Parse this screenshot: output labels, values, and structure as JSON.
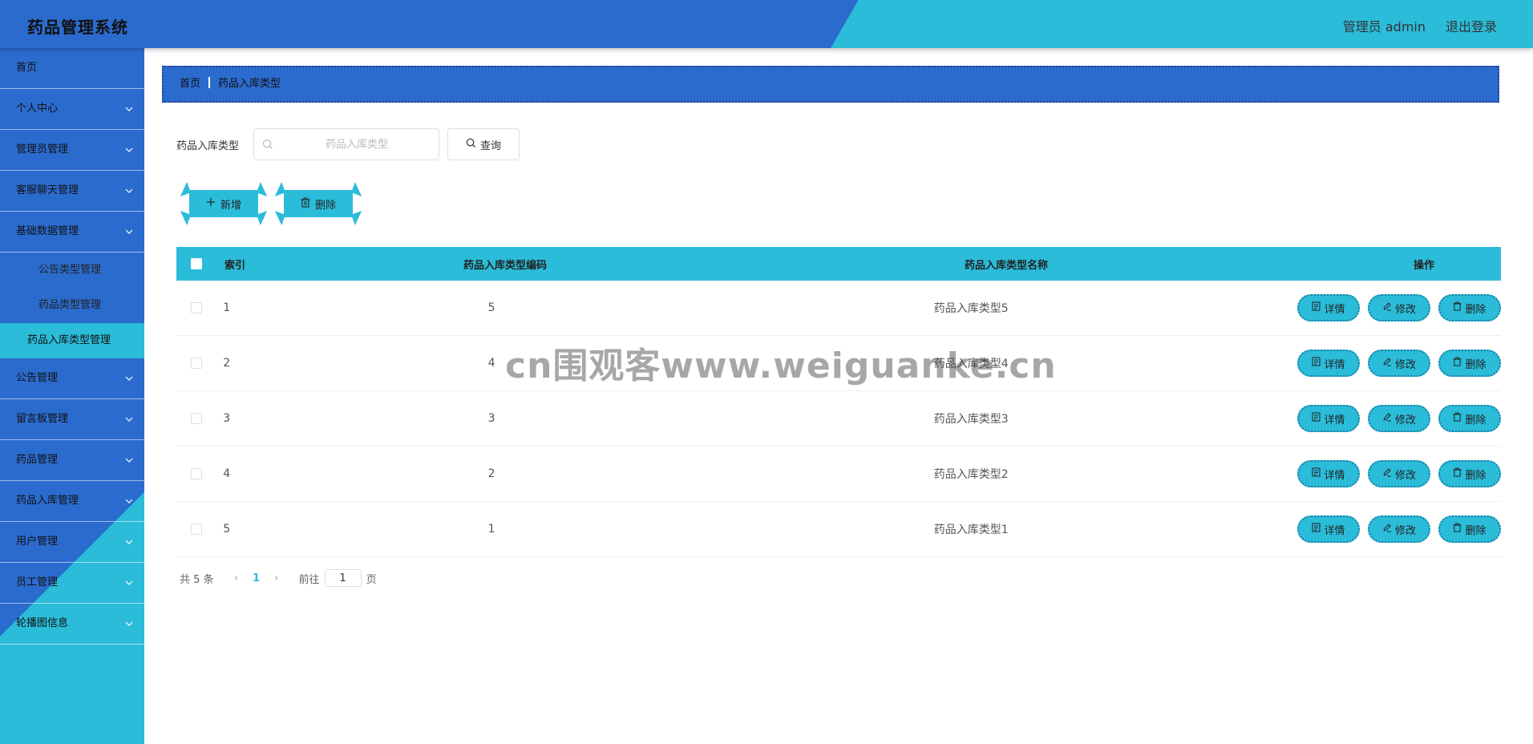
{
  "header": {
    "title": "药品管理系统",
    "user": "管理员 admin",
    "logout": "退出登录"
  },
  "sidebar": {
    "items": [
      {
        "label": "首页",
        "chevron": false
      },
      {
        "label": "个人中心",
        "chevron": true
      },
      {
        "label": "管理员管理",
        "chevron": true
      },
      {
        "label": "客服聊天管理",
        "chevron": true
      },
      {
        "label": "基础数据管理",
        "chevron": true
      }
    ],
    "sub_items": [
      {
        "label": "公告类型管理"
      },
      {
        "label": "药品类型管理"
      },
      {
        "label": "药品入库类型管理"
      }
    ],
    "items_after": [
      {
        "label": "公告管理"
      },
      {
        "label": "留言板管理"
      },
      {
        "label": "药品管理"
      },
      {
        "label": "药品入库管理"
      },
      {
        "label": "用户管理"
      },
      {
        "label": "员工管理"
      },
      {
        "label": "轮播图信息"
      }
    ]
  },
  "breadcrumb": {
    "home": "首页",
    "current": "药品入库类型"
  },
  "search": {
    "label": "药品入库类型",
    "placeholder": "药品入库类型",
    "value": "",
    "query_label": "查询"
  },
  "actions": {
    "add_label": "新增",
    "delete_label": "删除"
  },
  "table": {
    "headers": {
      "index": "索引",
      "code": "药品入库类型编码",
      "name": "药品入库类型名称",
      "ops": "操作"
    },
    "rows": [
      {
        "index": "1",
        "code": "5",
        "name": "药品入库类型5"
      },
      {
        "index": "2",
        "code": "4",
        "name": "药品入库类型4"
      },
      {
        "index": "3",
        "code": "3",
        "name": "药品入库类型3"
      },
      {
        "index": "4",
        "code": "2",
        "name": "药品入库类型2"
      },
      {
        "index": "5",
        "code": "1",
        "name": "药品入库类型1"
      }
    ],
    "op_labels": {
      "detail": "详情",
      "edit": "修改",
      "delete": "删除"
    }
  },
  "pagination": {
    "total": "共 5 条",
    "current_page": "1",
    "goto_prefix": "前往",
    "goto_value": "1",
    "goto_suffix": "页"
  },
  "watermark": "cn围观客www.weiguanke.cn",
  "colors": {
    "primary_blue": "#2b6bce",
    "accent_cyan": "#2bbcd9"
  },
  "icons": {
    "chevron": "chevron-down-icon",
    "search": "search-icon",
    "plus": "plus-icon",
    "trash": "trash-icon",
    "doc": "document-icon",
    "edit": "edit-icon"
  }
}
